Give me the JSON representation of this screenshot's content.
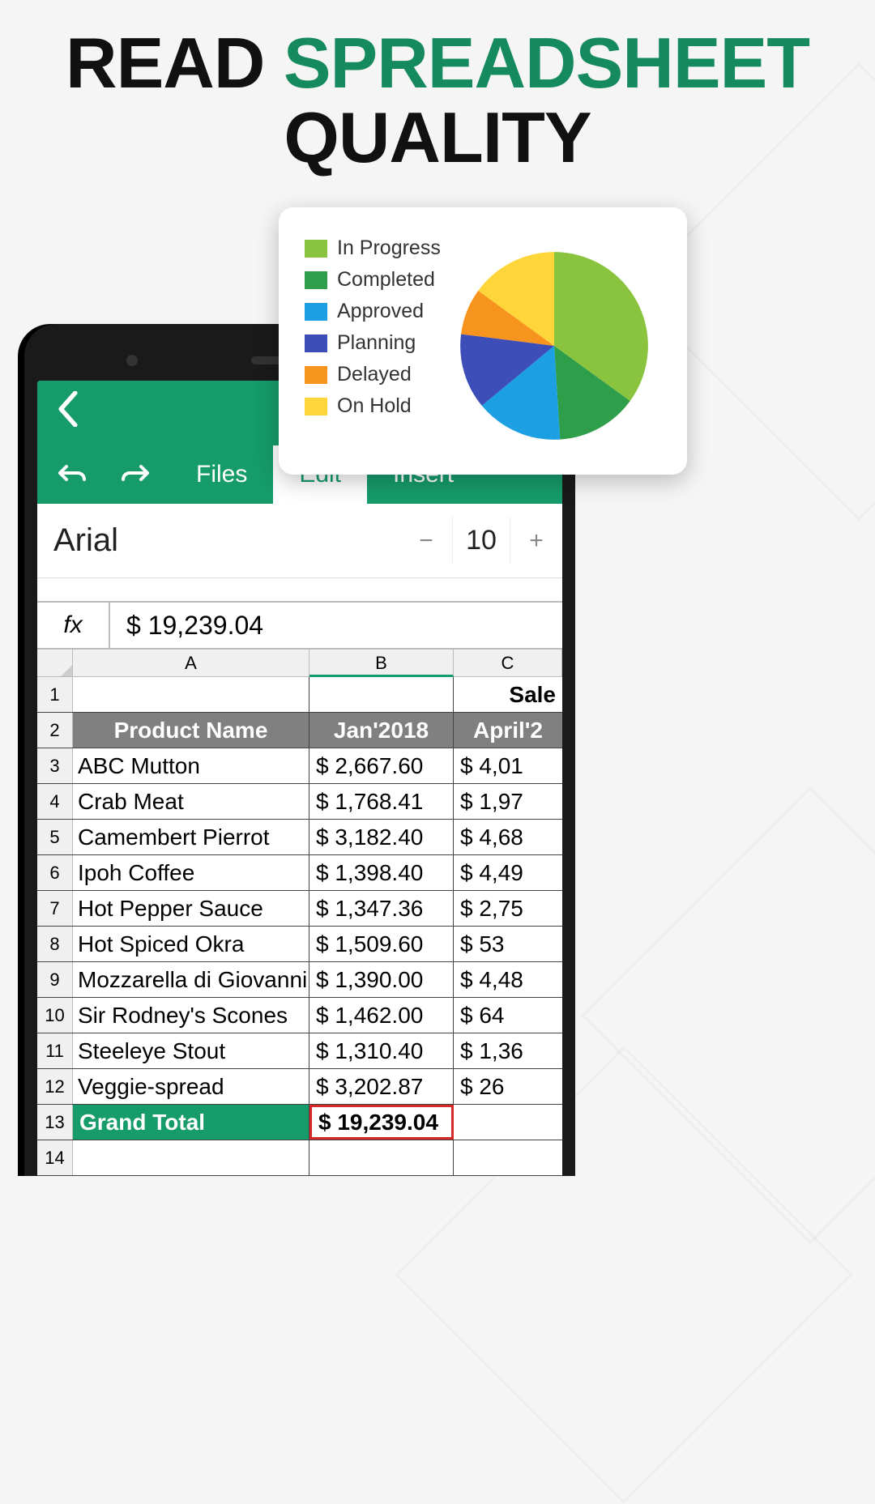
{
  "headline": {
    "word1": "READ",
    "word2": "SPREADSHEET",
    "word3": "QUALITY"
  },
  "tabs": {
    "files": "Files",
    "edit": "Edit",
    "insert": "Insert"
  },
  "font": {
    "name": "Arial",
    "size": "10"
  },
  "fx": {
    "label": "fx",
    "value": "$ 19,239.04"
  },
  "columns": {
    "A": "A",
    "B": "B",
    "C": "C"
  },
  "row1": {
    "c": "Sale"
  },
  "header_row": {
    "a": "Product Name",
    "b": "Jan'2018",
    "c": "April'2"
  },
  "rows": [
    {
      "n": "3",
      "a": "ABC Mutton",
      "b": "$   2,667.60",
      "c": "$    4,01"
    },
    {
      "n": "4",
      "a": "Crab Meat",
      "b": "$   1,768.41",
      "c": "$    1,97"
    },
    {
      "n": "5",
      "a": "Camembert Pierrot",
      "b": "$   3,182.40",
      "c": "$    4,68"
    },
    {
      "n": "6",
      "a": "Ipoh Coffee",
      "b": "$   1,398.40",
      "c": "$    4,49"
    },
    {
      "n": "7",
      "a": "Hot Pepper Sauce",
      "b": "$   1,347.36",
      "c": "$    2,75"
    },
    {
      "n": "8",
      "a": " Hot Spiced Okra",
      "b": "$   1,509.60",
      "c": "$        53"
    },
    {
      "n": "9",
      "a": "Mozzarella di Giovanni",
      "b": "$   1,390.00",
      "c": "$    4,48"
    },
    {
      "n": "10",
      "a": "Sir Rodney's Scones",
      "b": "$   1,462.00",
      "c": "$        64"
    },
    {
      "n": "11",
      "a": "Steeleye Stout",
      "b": "$   1,310.40",
      "c": "$    1,36"
    },
    {
      "n": "12",
      "a": "Veggie-spread",
      "b": "$   3,202.87",
      "c": "$        26"
    }
  ],
  "total_row": {
    "n": "13",
    "a": "Grand Total",
    "b": "$ 19,239.04",
    "c": ""
  },
  "last_row_num": "14",
  "chart_data": {
    "type": "pie",
    "series": [
      {
        "name": "In Progress",
        "value": 35,
        "color": "#8ac43f"
      },
      {
        "name": "Completed",
        "value": 14,
        "color": "#2e9e4a"
      },
      {
        "name": "Approved",
        "value": 15,
        "color": "#1ca0e3"
      },
      {
        "name": "Planning",
        "value": 13,
        "color": "#3e4eb8"
      },
      {
        "name": "Delayed",
        "value": 8,
        "color": "#f7941d"
      },
      {
        "name": "On Hold",
        "value": 15,
        "color": "#ffd63a"
      }
    ]
  }
}
